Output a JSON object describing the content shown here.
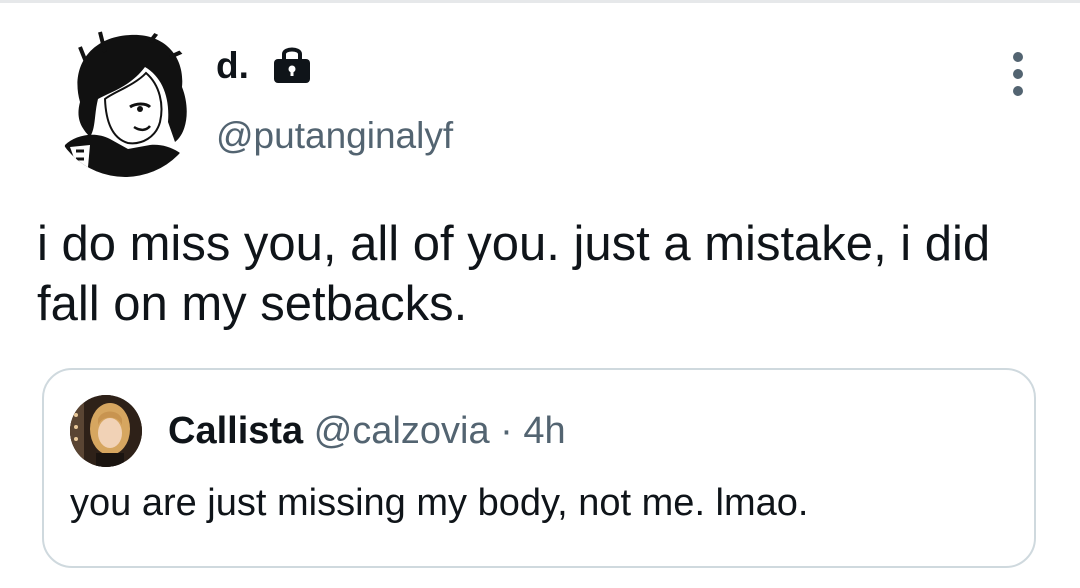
{
  "author": {
    "display_name": "d.",
    "handle": "@putanginalyf",
    "lock_icon": "lock-icon",
    "avatar_icon": "avatar"
  },
  "menu": {
    "icon": "more-vertical-icon"
  },
  "tweet": {
    "text": "i do miss you, all of you. just a mistake, i did fall on my setbacks."
  },
  "quoted_tweet": {
    "display_name": "Callista",
    "handle": "@calzovia",
    "separator": "·",
    "time": "4h",
    "text": "you are just missing my body, not me. lmao."
  },
  "colors": {
    "text_primary": "#0f1419",
    "text_secondary": "#536471",
    "card_border": "#cfd9de"
  }
}
